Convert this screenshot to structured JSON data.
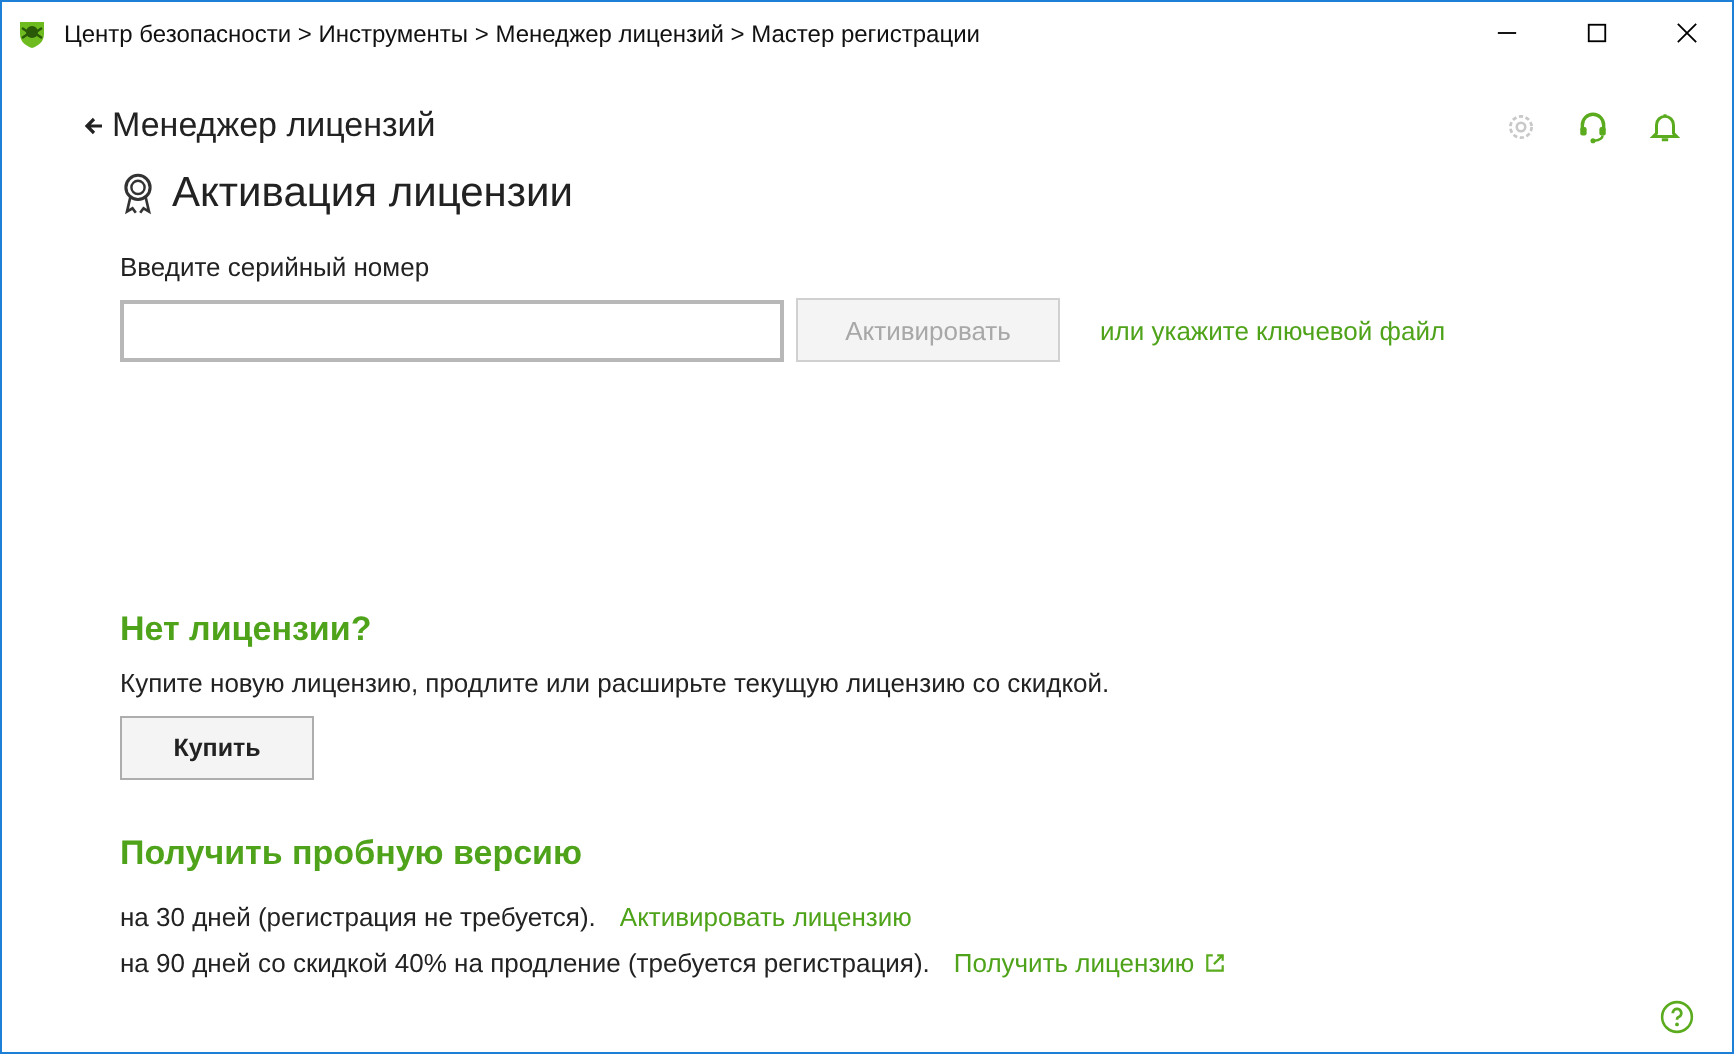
{
  "window": {
    "title": "Центр безопасности > Инструменты > Менеджер лицензий > Мастер регистрации"
  },
  "back_link": "Менеджер лицензий",
  "page_title": "Активация лицензии",
  "serial": {
    "label": "Введите серийный номер",
    "button": {
      "label": "Активировать",
      "disabled": true
    },
    "key_file_link": "или укажите ключевой файл"
  },
  "no_license": {
    "heading": "Нет лицензии?",
    "text": "Купите новую лицензию, продлите или расширьте текущую лицензию со скидкой.",
    "button": "Купить"
  },
  "trial": {
    "heading": "Получить пробную версию",
    "options": [
      {
        "text": "на 30 дней (регистрация не требуется).",
        "link": "Активировать лицензию",
        "external": false
      },
      {
        "text": "на 90 дней со скидкой 40% на продление (требуется регистрация).",
        "link": "Получить лицензию",
        "external": true
      }
    ]
  }
}
